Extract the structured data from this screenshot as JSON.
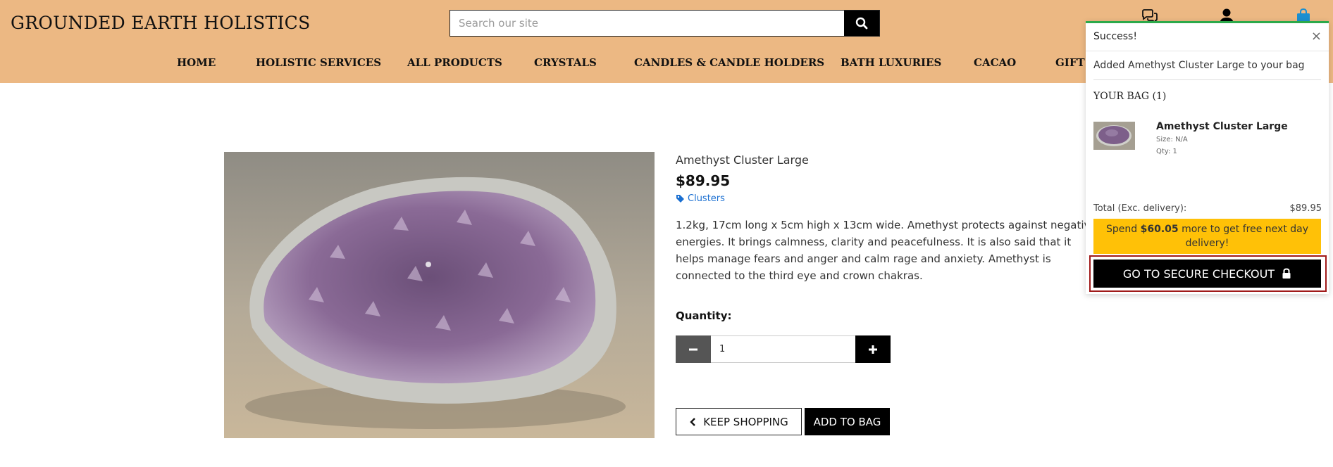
{
  "header": {
    "brand": "GROUNDED EARTH HOLISTICS",
    "search_placeholder": "Search our site",
    "icons": [
      "chat-icon",
      "account-icon",
      "bag-icon"
    ],
    "bg_color": "#ecb883"
  },
  "nav": {
    "items": [
      "HOME",
      "HOLISTIC SERVICES",
      "ALL PRODUCTS",
      "CRYSTALS",
      "CANDLES & CANDLE HOLDERS",
      "BATH LUXURIES",
      "CACAO",
      "GIFT"
    ]
  },
  "product": {
    "name": "Amethyst Cluster Large",
    "price": "$89.95",
    "category": "Clusters",
    "description": "1.2kg, 17cm long x 5cm high x 13cm wide. Amethyst protects against negative energies. It brings calmness, clarity and peacefulness. It is also said that it helps manage fears and anger and calm rage and anxiety. Amethyst is connected to the third eye and crown chakras.",
    "quantity_label": "Quantity:",
    "quantity_value": "1",
    "keep_shopping_label": "KEEP SHOPPING",
    "add_to_bag_label": "ADD TO BAG"
  },
  "toast": {
    "title": "Success!",
    "close": "×",
    "message": "Added Amethyst Cluster Large to your bag",
    "bag_title": "YOUR BAG (1)",
    "item": {
      "name": "Amethyst Cluster Large",
      "size": "Size: N/A",
      "qty": "Qty: 1"
    },
    "total_label": "Total (Exc. delivery):",
    "total_value": "$89.95",
    "promo_prefix": "Spend ",
    "promo_amount": "$60.05",
    "promo_suffix": " more to get free next day delivery!",
    "checkout_label": "GO TO SECURE CHECKOUT",
    "accent_color": "#2ca94a",
    "promo_color": "#ffc107"
  }
}
